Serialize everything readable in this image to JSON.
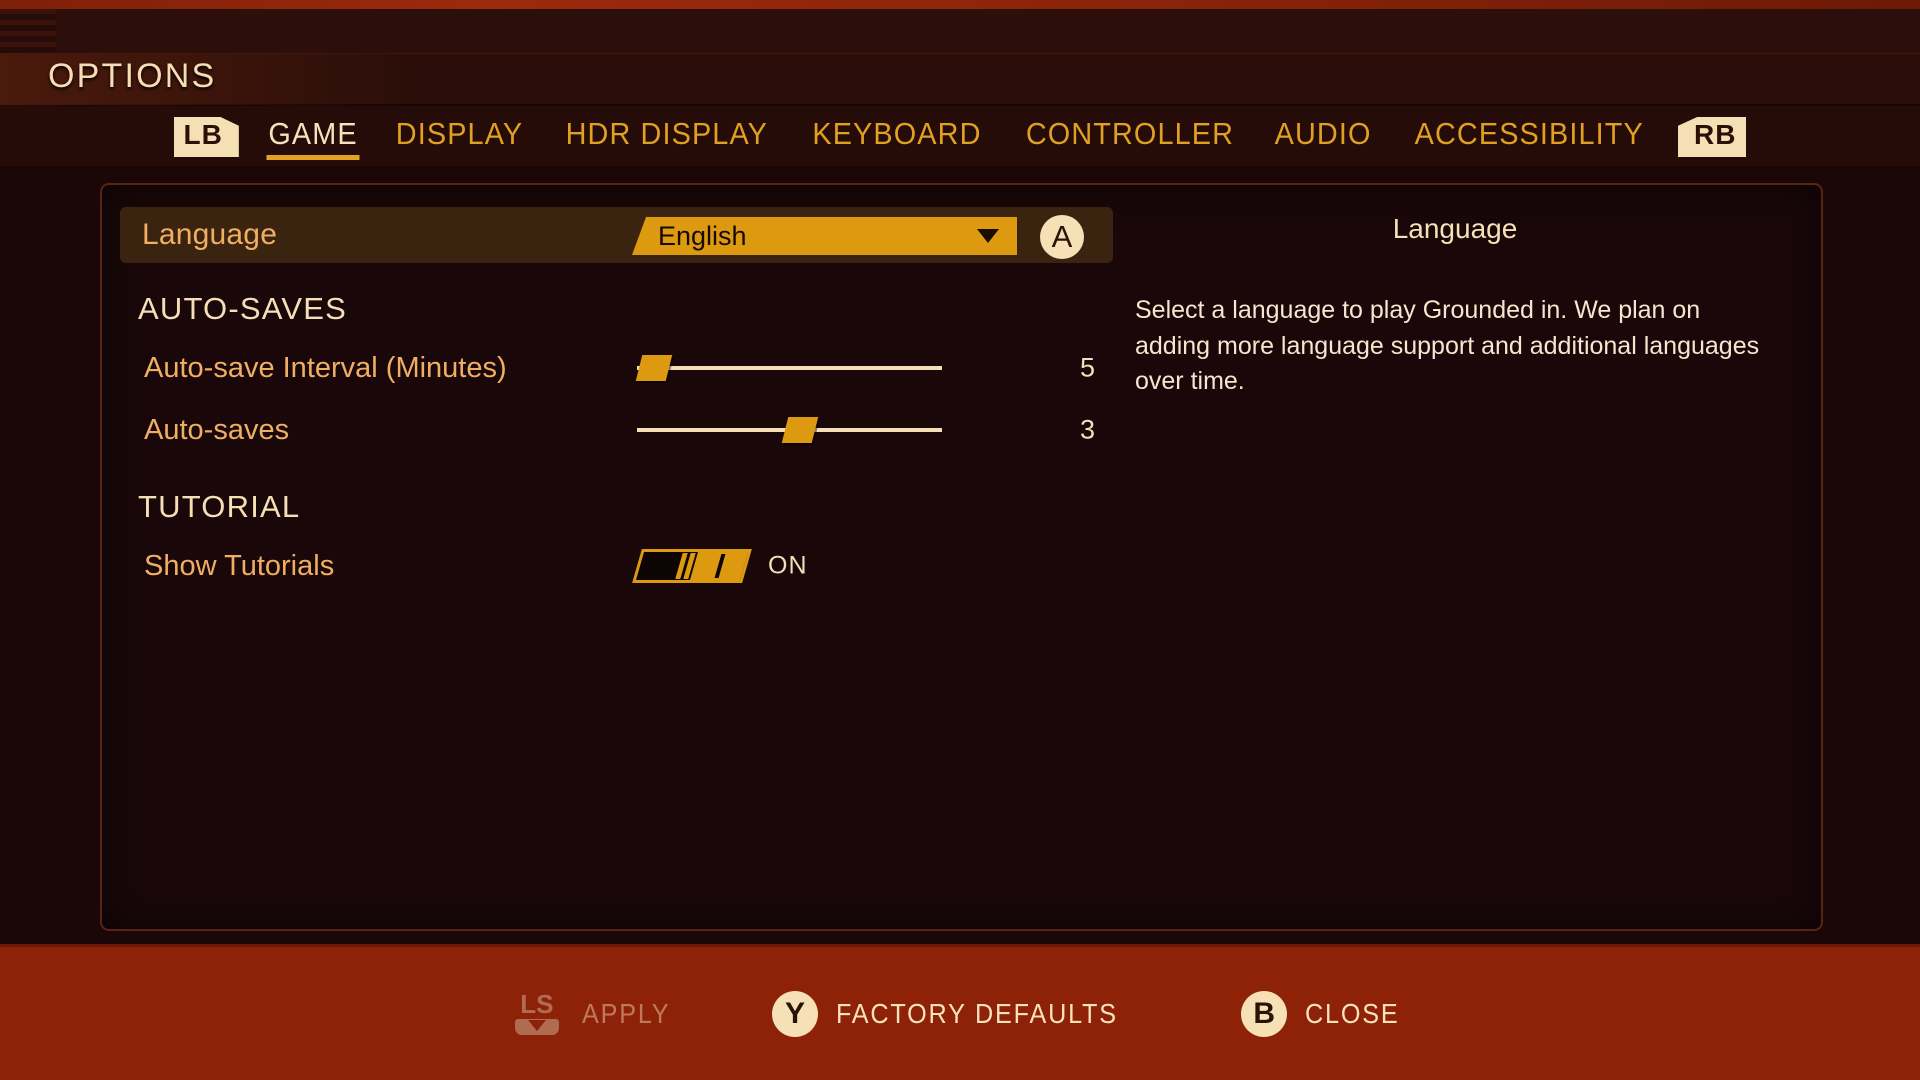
{
  "header": {
    "title": "OPTIONS"
  },
  "tabs": {
    "left_bumper": "LB",
    "right_bumper": "RB",
    "items": [
      {
        "label": "GAME",
        "active": true
      },
      {
        "label": "DISPLAY",
        "active": false
      },
      {
        "label": "HDR DISPLAY",
        "active": false
      },
      {
        "label": "KEYBOARD",
        "active": false
      },
      {
        "label": "CONTROLLER",
        "active": false
      },
      {
        "label": "AUDIO",
        "active": false
      },
      {
        "label": "ACCESSIBILITY",
        "active": false
      }
    ]
  },
  "settings": {
    "language_row": {
      "label": "Language",
      "value": "English",
      "confirm_button": "A"
    },
    "sections": [
      {
        "heading": "AUTO-SAVES",
        "rows": [
          {
            "label": "Auto-save Interval (Minutes)",
            "type": "slider",
            "value": "5",
            "fill_percent": 5
          },
          {
            "label": "Auto-saves",
            "type": "slider",
            "value": "3",
            "fill_percent": 50
          }
        ]
      },
      {
        "heading": "TUTORIAL",
        "rows": [
          {
            "label": "Show Tutorials",
            "type": "toggle",
            "value": "ON"
          }
        ]
      }
    ]
  },
  "description": {
    "title": "Language",
    "body": "Select a language to play Grounded in. We plan on adding more language support and additional languages over time."
  },
  "actions": [
    {
      "glyph": "LS",
      "label": "APPLY",
      "disabled": true
    },
    {
      "glyph": "Y",
      "label": "FACTORY DEFAULTS",
      "disabled": false
    },
    {
      "glyph": "B",
      "label": "CLOSE",
      "disabled": false
    }
  ],
  "colors": {
    "accent_orange": "#dd9a11",
    "cream": "#f6e1b6",
    "label_orange": "#f0ae63",
    "bar_red": "#8e2209",
    "panel_bg": "#190709"
  }
}
